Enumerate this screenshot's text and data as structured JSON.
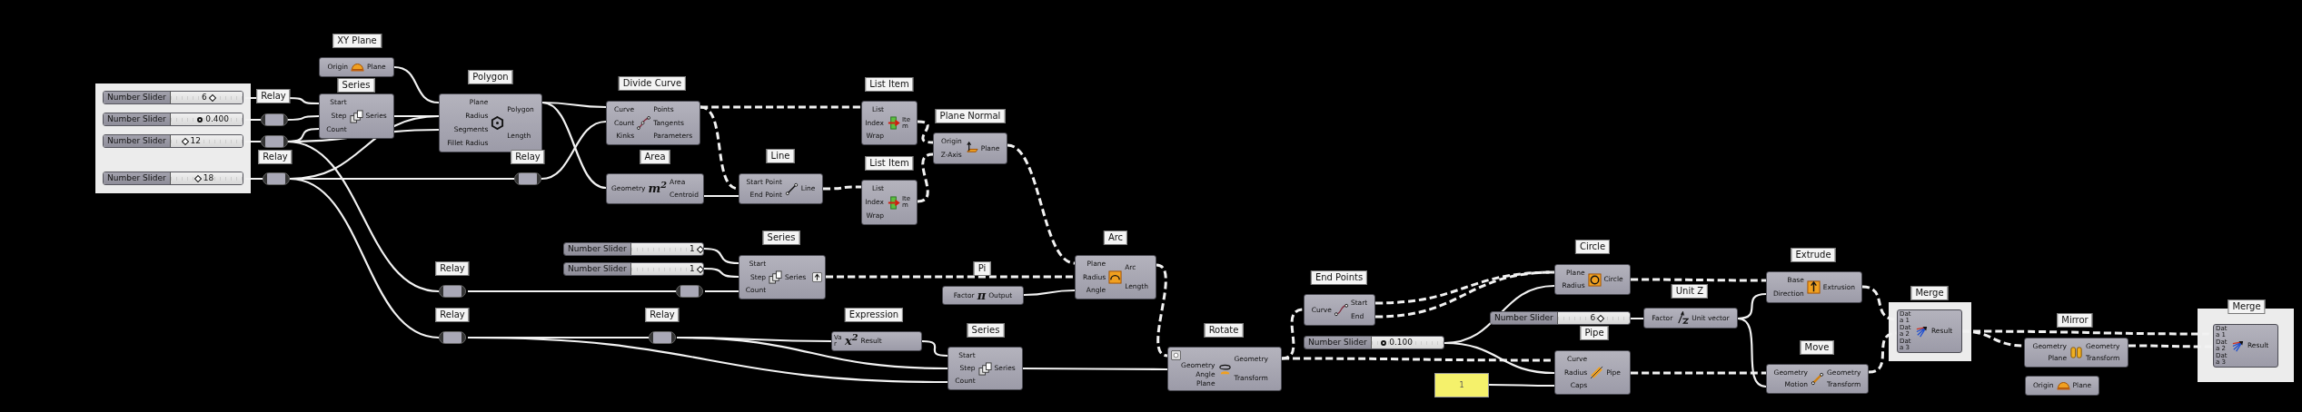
{
  "nodes": [
    {
      "kind": "slider",
      "name": "Number Slider",
      "value": "6",
      "decimal": false,
      "level": 0.58
    },
    {
      "kind": "slider",
      "name": "Number Slider",
      "value": "0.400",
      "decimal": true,
      "level": 0.41
    },
    {
      "kind": "slider",
      "name": "Number Slider",
      "value": "12",
      "decimal": false,
      "level": 0.2
    },
    {
      "kind": "slider",
      "name": "Number Slider",
      "value": "18",
      "decimal": false,
      "level": 0.38
    },
    {
      "kind": "relay",
      "label": "Relay"
    },
    {
      "kind": "relay"
    },
    {
      "kind": "relay"
    },
    {
      "kind": "relay",
      "label": "Relay"
    },
    {
      "kind": "component",
      "label": "XY Plane",
      "inputs": [
        "Origin"
      ],
      "outputs": [
        "Plane"
      ]
    },
    {
      "kind": "component",
      "label": "Series",
      "inputs": [
        "Start",
        "Step",
        "Count"
      ],
      "outputs": [
        "Series"
      ]
    },
    {
      "kind": "component",
      "label": "Polygon",
      "inputs": [
        "Plane",
        "Radius",
        "Segments",
        "Fillet Radius"
      ],
      "outputs": [
        "Polygon",
        "Length"
      ]
    },
    {
      "kind": "relay",
      "label": "Relay"
    },
    {
      "kind": "component",
      "label": "Divide Curve",
      "inputs": [
        "Curve",
        "Count",
        "Kinks"
      ],
      "outputs": [
        "Points",
        "Tangents",
        "Parameters"
      ]
    },
    {
      "kind": "component",
      "label": "Area",
      "inputs": [
        "Geometry"
      ],
      "outputs": [
        "Area",
        "Centroid"
      ],
      "icon_text": "m$^{2}$"
    },
    {
      "kind": "component",
      "label": "Line",
      "inputs": [
        "Start Point",
        "End Point"
      ],
      "outputs": [
        "Line"
      ]
    },
    {
      "kind": "component",
      "label": "List Item",
      "inputs": [
        "List",
        "Index",
        "Wrap"
      ],
      "outputs": [
        "Item"
      ]
    },
    {
      "kind": "component",
      "label": "List Item",
      "inputs": [
        "List",
        "Index",
        "Wrap"
      ],
      "outputs": [
        "Item"
      ]
    },
    {
      "kind": "component",
      "label": "Plane Normal",
      "inputs": [
        "Origin",
        "Z-Axis"
      ],
      "outputs": [
        "Plane"
      ]
    },
    {
      "kind": "slider",
      "name": "Number Slider",
      "value": "1",
      "decimal": false,
      "level": 0.96
    },
    {
      "kind": "slider",
      "name": "Number Slider",
      "value": "1",
      "decimal": false,
      "level": 0.96
    },
    {
      "kind": "component",
      "label": "Series",
      "inputs": [
        "Start",
        "Step",
        "Count"
      ],
      "outputs": [
        "Series"
      ]
    },
    {
      "kind": "relay",
      "label": "Relay"
    },
    {
      "kind": "relay"
    },
    {
      "kind": "relay",
      "label": "Relay"
    },
    {
      "kind": "relay",
      "label": "Relay"
    },
    {
      "kind": "component",
      "label": "Expression",
      "inputs": [
        "Var"
      ],
      "outputs": [
        "Result"
      ],
      "icon_text": "x$^{2}$"
    },
    {
      "kind": "component",
      "label": "Pi",
      "inputs": [
        "Factor"
      ],
      "outputs": [
        "Output"
      ],
      "icon_text": "π"
    },
    {
      "kind": "component",
      "label": "Arc",
      "inputs": [
        "Plane",
        "Radius",
        "Angle"
      ],
      "outputs": [
        "Arc",
        "Length"
      ]
    },
    {
      "kind": "component",
      "label": "Series",
      "inputs": [
        "Start",
        "Step",
        "Count"
      ],
      "outputs": [
        "Series"
      ]
    },
    {
      "kind": "component",
      "label": "Rotate",
      "inputs": [
        "Geometry",
        "Angle",
        "Plane"
      ],
      "outputs": [
        "Geometry",
        "Transform"
      ]
    },
    {
      "kind": "component",
      "label": "End Points",
      "inputs": [
        "Curve"
      ],
      "outputs": [
        "Start",
        "End"
      ]
    },
    {
      "kind": "slider",
      "name": "Number Slider",
      "value": "0.100",
      "decimal": true,
      "level": 0.17
    },
    {
      "kind": "component",
      "label": "Circle",
      "inputs": [
        "Plane",
        "Radius"
      ],
      "outputs": [
        "Circle"
      ]
    },
    {
      "kind": "slider",
      "name": "Number Slider",
      "value": "6",
      "decimal": false,
      "level": 0.6
    },
    {
      "kind": "component",
      "label": "Unit Z",
      "inputs": [
        "Factor"
      ],
      "outputs": [
        "Unit vector"
      ]
    },
    {
      "kind": "panel",
      "text": "1"
    },
    {
      "kind": "component",
      "label": "Pipe",
      "inputs": [
        "Curve",
        "Radius",
        "Caps"
      ],
      "outputs": [
        "Pipe"
      ]
    },
    {
      "kind": "component",
      "label": "Extrude",
      "inputs": [
        "Base",
        "Direction"
      ],
      "outputs": [
        "Extrusion"
      ]
    },
    {
      "kind": "component",
      "label": "Move",
      "inputs": [
        "Geometry",
        "Motion"
      ],
      "outputs": [
        "Geometry",
        "Transform"
      ]
    },
    {
      "kind": "component",
      "label": "Merge",
      "inputs": [
        "Data 1",
        "Data 2",
        "Data 3"
      ],
      "outputs": [
        "Result"
      ]
    },
    {
      "kind": "component",
      "label": "Mirror",
      "inputs": [
        "Geometry",
        "Plane"
      ],
      "outputs": [
        "Geometry",
        "Transform"
      ]
    },
    {
      "kind": "component",
      "inputs": [
        "Origin"
      ],
      "outputs": [
        "Plane"
      ]
    },
    {
      "kind": "component",
      "label": "Merge",
      "inputs": [
        "Data 1",
        "Data 2",
        "Data 3"
      ],
      "outputs": [
        "Result"
      ]
    }
  ]
}
